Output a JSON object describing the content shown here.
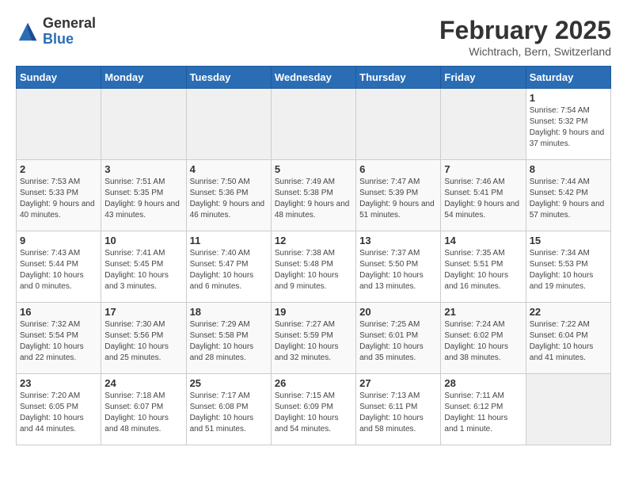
{
  "header": {
    "logo_general": "General",
    "logo_blue": "Blue",
    "month_title": "February 2025",
    "subtitle": "Wichtrach, Bern, Switzerland"
  },
  "weekdays": [
    "Sunday",
    "Monday",
    "Tuesday",
    "Wednesday",
    "Thursday",
    "Friday",
    "Saturday"
  ],
  "weeks": [
    [
      {
        "day": "",
        "info": ""
      },
      {
        "day": "",
        "info": ""
      },
      {
        "day": "",
        "info": ""
      },
      {
        "day": "",
        "info": ""
      },
      {
        "day": "",
        "info": ""
      },
      {
        "day": "",
        "info": ""
      },
      {
        "day": "1",
        "info": "Sunrise: 7:54 AM\nSunset: 5:32 PM\nDaylight: 9 hours and 37 minutes."
      }
    ],
    [
      {
        "day": "2",
        "info": "Sunrise: 7:53 AM\nSunset: 5:33 PM\nDaylight: 9 hours and 40 minutes."
      },
      {
        "day": "3",
        "info": "Sunrise: 7:51 AM\nSunset: 5:35 PM\nDaylight: 9 hours and 43 minutes."
      },
      {
        "day": "4",
        "info": "Sunrise: 7:50 AM\nSunset: 5:36 PM\nDaylight: 9 hours and 46 minutes."
      },
      {
        "day": "5",
        "info": "Sunrise: 7:49 AM\nSunset: 5:38 PM\nDaylight: 9 hours and 48 minutes."
      },
      {
        "day": "6",
        "info": "Sunrise: 7:47 AM\nSunset: 5:39 PM\nDaylight: 9 hours and 51 minutes."
      },
      {
        "day": "7",
        "info": "Sunrise: 7:46 AM\nSunset: 5:41 PM\nDaylight: 9 hours and 54 minutes."
      },
      {
        "day": "8",
        "info": "Sunrise: 7:44 AM\nSunset: 5:42 PM\nDaylight: 9 hours and 57 minutes."
      }
    ],
    [
      {
        "day": "9",
        "info": "Sunrise: 7:43 AM\nSunset: 5:44 PM\nDaylight: 10 hours and 0 minutes."
      },
      {
        "day": "10",
        "info": "Sunrise: 7:41 AM\nSunset: 5:45 PM\nDaylight: 10 hours and 3 minutes."
      },
      {
        "day": "11",
        "info": "Sunrise: 7:40 AM\nSunset: 5:47 PM\nDaylight: 10 hours and 6 minutes."
      },
      {
        "day": "12",
        "info": "Sunrise: 7:38 AM\nSunset: 5:48 PM\nDaylight: 10 hours and 9 minutes."
      },
      {
        "day": "13",
        "info": "Sunrise: 7:37 AM\nSunset: 5:50 PM\nDaylight: 10 hours and 13 minutes."
      },
      {
        "day": "14",
        "info": "Sunrise: 7:35 AM\nSunset: 5:51 PM\nDaylight: 10 hours and 16 minutes."
      },
      {
        "day": "15",
        "info": "Sunrise: 7:34 AM\nSunset: 5:53 PM\nDaylight: 10 hours and 19 minutes."
      }
    ],
    [
      {
        "day": "16",
        "info": "Sunrise: 7:32 AM\nSunset: 5:54 PM\nDaylight: 10 hours and 22 minutes."
      },
      {
        "day": "17",
        "info": "Sunrise: 7:30 AM\nSunset: 5:56 PM\nDaylight: 10 hours and 25 minutes."
      },
      {
        "day": "18",
        "info": "Sunrise: 7:29 AM\nSunset: 5:58 PM\nDaylight: 10 hours and 28 minutes."
      },
      {
        "day": "19",
        "info": "Sunrise: 7:27 AM\nSunset: 5:59 PM\nDaylight: 10 hours and 32 minutes."
      },
      {
        "day": "20",
        "info": "Sunrise: 7:25 AM\nSunset: 6:01 PM\nDaylight: 10 hours and 35 minutes."
      },
      {
        "day": "21",
        "info": "Sunrise: 7:24 AM\nSunset: 6:02 PM\nDaylight: 10 hours and 38 minutes."
      },
      {
        "day": "22",
        "info": "Sunrise: 7:22 AM\nSunset: 6:04 PM\nDaylight: 10 hours and 41 minutes."
      }
    ],
    [
      {
        "day": "23",
        "info": "Sunrise: 7:20 AM\nSunset: 6:05 PM\nDaylight: 10 hours and 44 minutes."
      },
      {
        "day": "24",
        "info": "Sunrise: 7:18 AM\nSunset: 6:07 PM\nDaylight: 10 hours and 48 minutes."
      },
      {
        "day": "25",
        "info": "Sunrise: 7:17 AM\nSunset: 6:08 PM\nDaylight: 10 hours and 51 minutes."
      },
      {
        "day": "26",
        "info": "Sunrise: 7:15 AM\nSunset: 6:09 PM\nDaylight: 10 hours and 54 minutes."
      },
      {
        "day": "27",
        "info": "Sunrise: 7:13 AM\nSunset: 6:11 PM\nDaylight: 10 hours and 58 minutes."
      },
      {
        "day": "28",
        "info": "Sunrise: 7:11 AM\nSunset: 6:12 PM\nDaylight: 11 hours and 1 minute."
      },
      {
        "day": "",
        "info": ""
      }
    ]
  ]
}
